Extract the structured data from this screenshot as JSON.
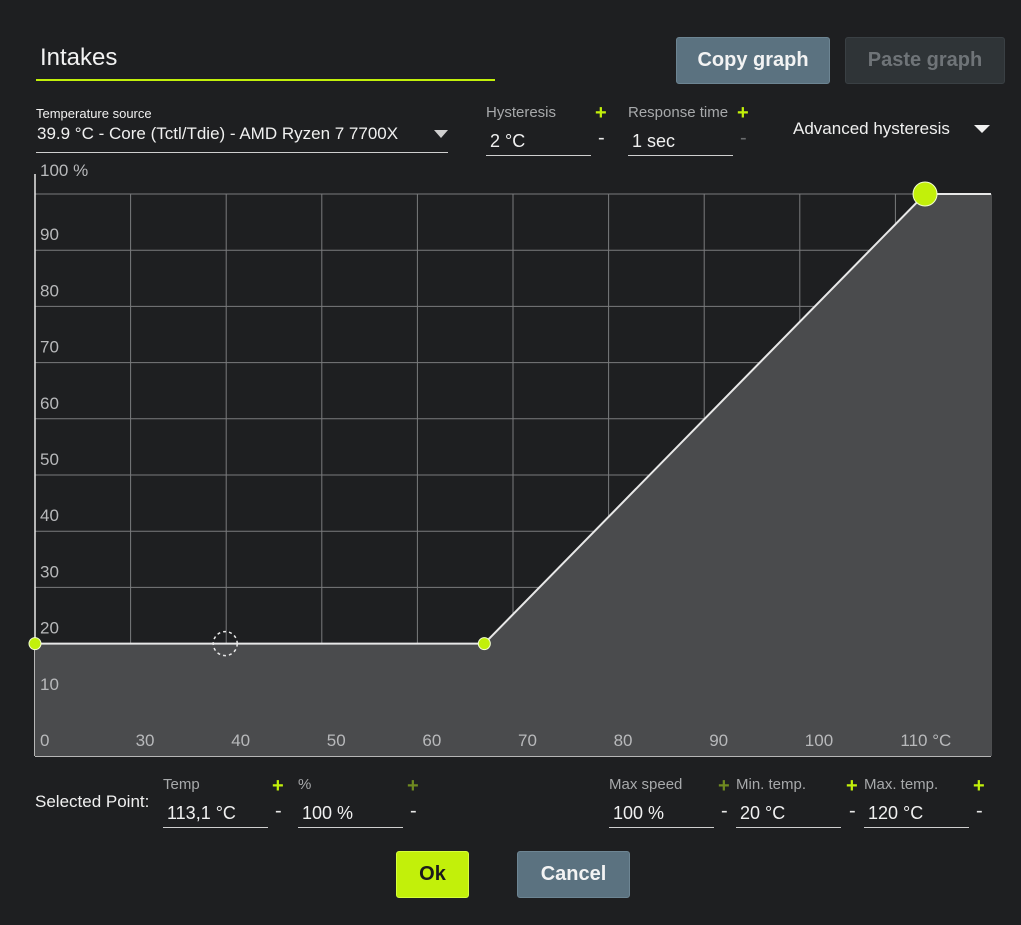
{
  "curve": {
    "name": "Intakes",
    "copy_label": "Copy graph",
    "paste_label": "Paste graph"
  },
  "temperature_source": {
    "label": "Temperature source",
    "value": "39.9 °C - Core (Tctl/Tdie) - AMD Ryzen 7 7700X"
  },
  "hysteresis": {
    "label": "Hysteresis",
    "value": "2 °C",
    "plus": "+",
    "minus": "-"
  },
  "response_time": {
    "label": "Response time",
    "value": "1 sec",
    "plus": "+",
    "minus": "-"
  },
  "advanced_hysteresis": {
    "label": "Advanced hysteresis"
  },
  "colors": {
    "accent": "#c2f00a",
    "button": "#5b7280",
    "background": "#1e1f21",
    "fill": "#4a4b4d"
  },
  "chart_data": {
    "type": "area",
    "x_ticks": [
      "0",
      "30",
      "40",
      "50",
      "60",
      "70",
      "80",
      "90",
      "100",
      "110 °C"
    ],
    "y_ticks": [
      "10",
      "20",
      "30",
      "40",
      "50",
      "60",
      "70",
      "80",
      "90",
      "100 %"
    ],
    "xlim": [
      20,
      120
    ],
    "ylim": [
      0,
      100
    ],
    "points": [
      {
        "x": 20,
        "y": 20
      },
      {
        "x": 67,
        "y": 20
      },
      {
        "x": 113.1,
        "y": 100
      }
    ],
    "current_marker": {
      "x": 39.9,
      "y": 20
    },
    "grid": true
  },
  "selected_point": {
    "label": "Selected Point:",
    "temp_label": "Temp",
    "temp_value": "113,1 °C",
    "percent_label": "%",
    "percent_value": "100 %"
  },
  "limits": {
    "max_speed_label": "Max speed",
    "max_speed_value": "100 %",
    "min_temp_label": "Min. temp.",
    "min_temp_value": "20 °C",
    "max_temp_label": "Max. temp.",
    "max_temp_value": "120 °C"
  },
  "dialog": {
    "ok_label": "Ok",
    "cancel_label": "Cancel"
  },
  "symbols": {
    "plus": "+",
    "minus": "-"
  }
}
